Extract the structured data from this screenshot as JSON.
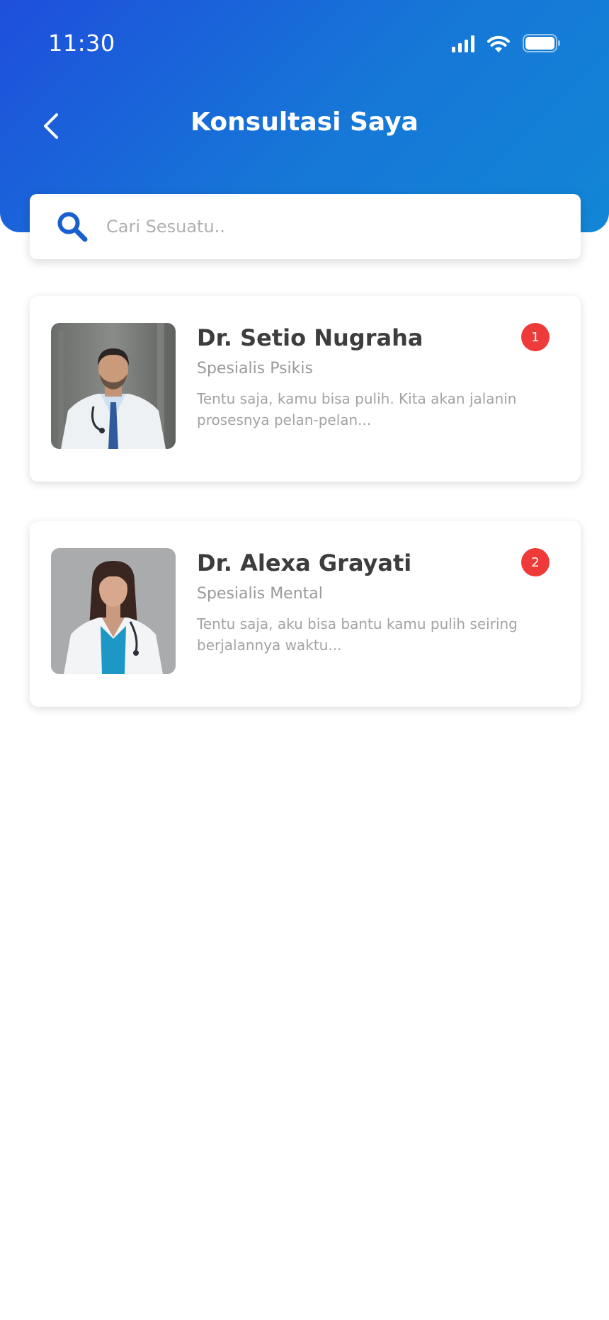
{
  "status_bar": {
    "time": "11:30"
  },
  "header": {
    "title": "Konsultasi Saya",
    "back_icon": "chevron-left-icon"
  },
  "search": {
    "placeholder": "Cari Sesuatu..",
    "value": ""
  },
  "colors": {
    "header_gradient_start": "#1e4fdc",
    "header_gradient_end": "#1286d6",
    "badge": "#ef3a3a",
    "search_icon": "#1a5fd0",
    "name_text": "#3d3d3d",
    "muted_text": "#9a9a9a"
  },
  "consultations": [
    {
      "name": "Dr. Setio Nugraha",
      "specialty": "Spesialis Psikis",
      "message": "Tentu saja, kamu bisa pulih. Kita akan jalanin prosesnya pelan-pelan...",
      "unread": "1"
    },
    {
      "name": "Dr. Alexa Grayati",
      "specialty": "Spesialis Mental",
      "message": "Tentu saja, aku bisa bantu kamu pulih seiring berjalannya waktu...",
      "unread": "2"
    }
  ]
}
